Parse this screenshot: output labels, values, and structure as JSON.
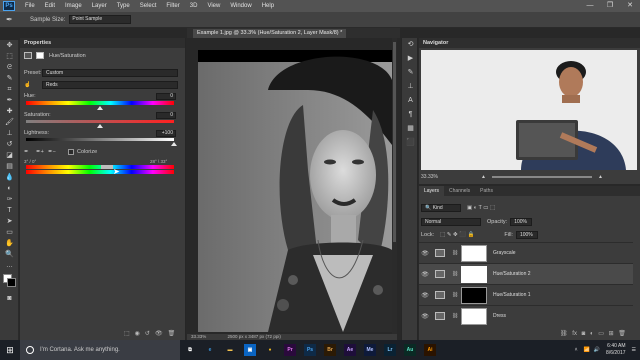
{
  "app": {
    "logo": "Ps",
    "menus": [
      "File",
      "Edit",
      "Image",
      "Layer",
      "Type",
      "Select",
      "Filter",
      "3D",
      "View",
      "Window",
      "Help"
    ],
    "window_controls": [
      "—",
      "❐",
      "✕"
    ]
  },
  "options_bar": {
    "tool_icon": "eyedropper-icon",
    "sample_size_label": "Sample Size:",
    "sample_size_value": "Point Sample"
  },
  "toolbar": {
    "tools": [
      "move-tool",
      "marquee-tool",
      "lasso-tool",
      "quick-select-tool",
      "crop-tool",
      "eyedropper-tool",
      "healing-tool",
      "brush-tool",
      "clone-stamp-tool",
      "history-brush-tool",
      "eraser-tool",
      "gradient-tool",
      "blur-tool",
      "dodge-tool",
      "pen-tool",
      "type-tool",
      "path-select-tool",
      "rectangle-tool",
      "hand-tool",
      "zoom-tool",
      "more-tools"
    ],
    "foreground_color": "#ffffff",
    "background_color": "#000000"
  },
  "properties": {
    "tab_title": "Properties",
    "adjustment_name": "Hue/Saturation",
    "preset_label": "Preset:",
    "preset_value": "Custom",
    "channel_value": "Reds",
    "hue_label": "Hue:",
    "hue_value": "0",
    "saturation_label": "Saturation:",
    "saturation_value": "0",
    "lightness_label": "Lightness:",
    "lightness_value": "+100",
    "colorize_label": "Colorize",
    "range_left": "3° / 0°",
    "range_right": "28° \\ 33°"
  },
  "document": {
    "tab_title": "Example 1.jpg @ 33.3% (Hue/Saturation 2, Layer Mask/8) *",
    "zoom": "33.33%",
    "status": "2500 px x 3487 px (72 ppi)"
  },
  "navigator": {
    "tab_title": "Navigator",
    "zoom": "33.33%"
  },
  "layers": {
    "tabs": [
      "Layers",
      "Channels",
      "Paths"
    ],
    "kind_label": "Kind",
    "blend_mode": "Normal",
    "opacity_label": "Opacity:",
    "opacity_value": "100%",
    "lock_label": "Lock:",
    "fill_label": "Fill:",
    "fill_value": "100%",
    "items": [
      {
        "name": "Grayscale",
        "mask": "#ffffff",
        "selected": false
      },
      {
        "name": "Hue/Saturation 2",
        "mask": "#ffffff",
        "selected": true
      },
      {
        "name": "Hue/Saturation 1",
        "mask": "#000000",
        "selected": false
      },
      {
        "name": "Dress",
        "mask": "#ffffff",
        "selected": false
      }
    ]
  },
  "taskbar": {
    "cortana_text": "I'm Cortana. Ask me anything.",
    "apps": [
      {
        "name": "task-view",
        "label": "⧉",
        "color": "#ffffff",
        "bg": "transparent"
      },
      {
        "name": "edge",
        "label": "e",
        "color": "#3a96dd",
        "bg": "transparent"
      },
      {
        "name": "file-explorer",
        "label": "▬",
        "color": "#f2c14e",
        "bg": "transparent"
      },
      {
        "name": "store",
        "label": "▣",
        "color": "#ffffff",
        "bg": "#0a64c2"
      },
      {
        "name": "chrome",
        "label": "●",
        "color": "#e8b321",
        "bg": "transparent"
      },
      {
        "name": "premiere",
        "label": "Pr",
        "color": "#e77cf4",
        "bg": "#2a0a3c"
      },
      {
        "name": "photoshop",
        "label": "Ps",
        "color": "#4aa3f0",
        "bg": "#0e2a47"
      },
      {
        "name": "bridge",
        "label": "Br",
        "color": "#e2a44e",
        "bg": "#2b1a05"
      },
      {
        "name": "after-effects",
        "label": "Ae",
        "color": "#c6a4ff",
        "bg": "#1e0e3a"
      },
      {
        "name": "media-encoder",
        "label": "Me",
        "color": "#b0c0ff",
        "bg": "#0e1a3a"
      },
      {
        "name": "lightroom",
        "label": "Lr",
        "color": "#7fc7ff",
        "bg": "#0a2233"
      },
      {
        "name": "audition",
        "label": "Au",
        "color": "#5ae0c3",
        "bg": "#0a2a24"
      },
      {
        "name": "illustrator",
        "label": "Ai",
        "color": "#ff9a00",
        "bg": "#2a1300"
      }
    ],
    "time": "6:40 AM",
    "date": "8/6/2017"
  }
}
